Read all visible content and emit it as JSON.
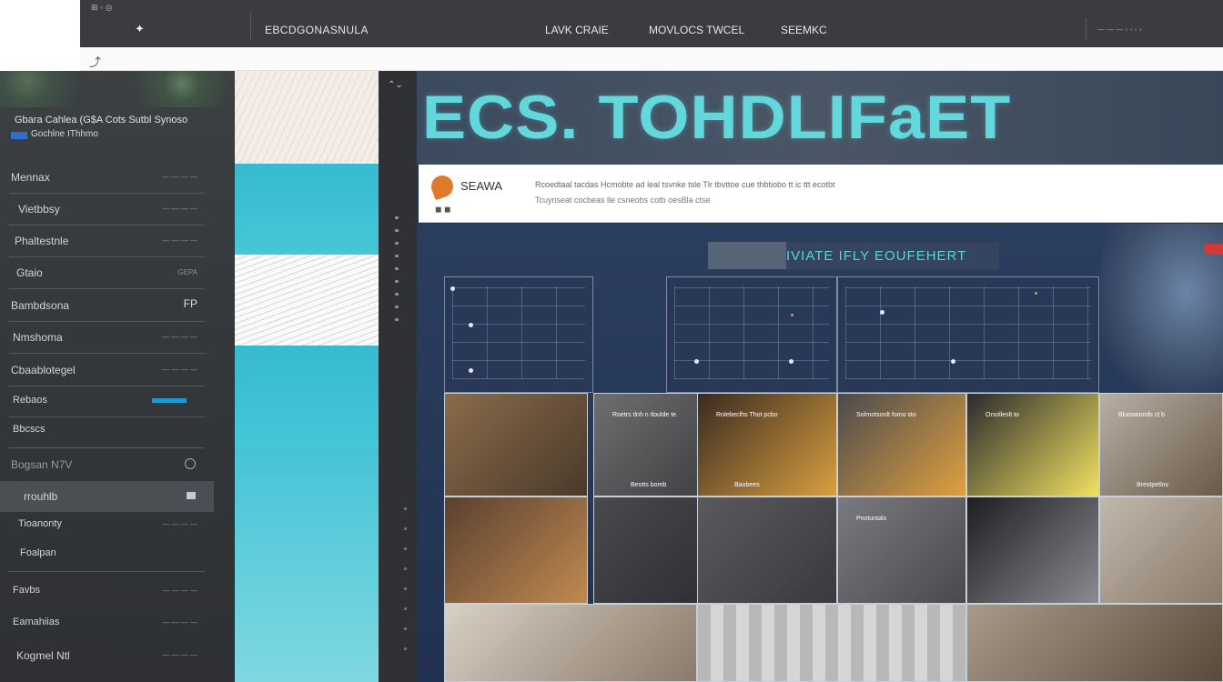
{
  "topbar": {
    "mini_label": "⊞ ◦ ◎",
    "logo_glyph": "✦",
    "brand": "EBCDGONASNULA",
    "nav": [
      "LAVK CRAIE",
      "MOVLOCS TWCEL",
      "SEEMKC"
    ],
    "search_hint": "— — — ◦ ◦ ◦ ◦"
  },
  "addr": {
    "cursor": "⤴"
  },
  "sidebar": {
    "profile_line1": "Gbara Cahlea  (G$A  Cots Sutbl  Synoso",
    "profile_line2": "Gochlne IThhmo",
    "items": [
      {
        "label": "Mennax",
        "meta": "— — — —"
      },
      {
        "label": "Vietbbsy",
        "meta": "— — — —"
      },
      {
        "label": "Phaltestnle",
        "meta": "— — — —"
      },
      {
        "label": "Gtaio",
        "meta": "GEPA"
      },
      {
        "label": "Bambdsona",
        "meta": "FP"
      },
      {
        "label": "Nmshoma",
        "meta": "— — — —"
      },
      {
        "label": "Cbaablotegel",
        "meta": "— — — —"
      },
      {
        "label": "Rebaos",
        "meta": ""
      },
      {
        "label": "Bbcscs",
        "meta": ""
      },
      {
        "label": "Bogsan  N7V",
        "meta": ""
      },
      {
        "label": "rrouhlb",
        "meta": ""
      },
      {
        "label": "Tioanonty",
        "meta": "— — — —"
      },
      {
        "label": "Foalpan",
        "meta": ""
      },
      {
        "label": "Favbs",
        "meta": "— — — —"
      },
      {
        "label": "Eamahiias",
        "meta": "— — — —"
      },
      {
        "label": "Kogmel  Ntl",
        "meta": "— — — —"
      }
    ]
  },
  "toolcol": {
    "top": "⌃⌄"
  },
  "main": {
    "hero_title": "ECS. TOHDLIFaET",
    "brand": "SEAWA",
    "icons": "◼ ◼",
    "text_line1": "Rcoedtaal tacdas  Hcmobte  ad leal tsvnke tsle Tlr  tbvttoe cue thbtiobo  tt  ic  ttt  ecotbt",
    "text_line2": "Tcuynseat  cocbeas  lle  csneobs  cotb  oesBla  ctse",
    "featured": "IVIATE  IFLY EOUFEHERT",
    "photo_captions": [
      {
        "a": "",
        "b": ""
      },
      {
        "a": "Roetrs tlnh  n tloulde  te",
        "b": "Beotts bomb"
      },
      {
        "a": "Rolebeclhs  Thot  pcbo",
        "b": "Baobees"
      },
      {
        "a": "Solrnotsonlt  fomo  sto",
        "b": ""
      },
      {
        "a": "Orsolleslt  to",
        "b": ""
      },
      {
        "a": "Bluoswonds ct  b",
        "b": "Brestpetlns"
      },
      {
        "a": "",
        "b": ""
      },
      {
        "a": "",
        "b": ""
      },
      {
        "a": "",
        "b": ""
      },
      {
        "a": "Pnotuntals",
        "b": ""
      },
      {
        "a": "",
        "b": ""
      },
      {
        "a": "",
        "b": ""
      }
    ]
  },
  "colors": {
    "accent": "#62d8dc",
    "topbar": "#3a3c40",
    "sidebar": "#34373a",
    "main_bg": "#25344f"
  }
}
